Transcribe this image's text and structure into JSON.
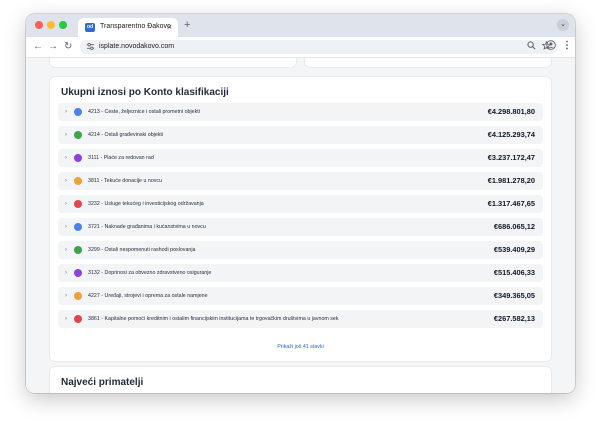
{
  "browser": {
    "tab_title": "Transparentno Đakovo",
    "favicon_text": "od",
    "new_tab": "+",
    "tab_close": "×",
    "tab_menu": "⌄",
    "url": "isplate.novodakovo.com",
    "nav": {
      "back": "←",
      "forward": "→",
      "reload": "↻"
    },
    "icons": {
      "site": "tune-icon",
      "zoom": "zoom-icon",
      "bookmark": "star-icon",
      "profile": "account-icon",
      "menu": "more-vert-icon"
    }
  },
  "konto": {
    "title": "Ukupni iznosi po Konto klasifikaciji",
    "rows": [
      {
        "label": "4213 - Ceste, željeznice i ostali prometni objekti",
        "amount": "€4.298.801,80",
        "color": "#4f82e8"
      },
      {
        "label": "4214 - Ostali građevinski objekti",
        "amount": "€4.125.293,74",
        "color": "#3fa34d"
      },
      {
        "label": "3111 - Plaće za redovan rad",
        "amount": "€3.237.172,47",
        "color": "#8e44d8"
      },
      {
        "label": "3811 - Tekuće donacije u novcu",
        "amount": "€1.981.278,20",
        "color": "#eea33a"
      },
      {
        "label": "3232 - Usluge tekućeg i investicijskog održavanja",
        "amount": "€1.317.467,65",
        "color": "#e0464a"
      },
      {
        "label": "3721 - Naknade građanima i kućanstvima u novcu",
        "amount": "€686.065,12",
        "color": "#4f82e8"
      },
      {
        "label": "3299 - Ostali nespomenuti rashodi poslovanja",
        "amount": "€539.409,29",
        "color": "#3fa34d"
      },
      {
        "label": "3132 - Doprinosi za obvezno zdravstveno osiguranje",
        "amount": "€515.406,33",
        "color": "#8e44d8"
      },
      {
        "label": "4227 - Uređaji, strojevi i oprema za ostale namjene",
        "amount": "€349.365,05",
        "color": "#eea33a"
      },
      {
        "label": "3861 - Kapitalne pomoći kreditnim i ostalim financijskim institucijama te trgovačkim društvima u javnom sek",
        "amount": "€267.582,13",
        "color": "#e0464a"
      }
    ],
    "chevron": "›",
    "more_link": "Prikaži još 41 stavki"
  },
  "primatelji": {
    "title": "Najveći primatelji"
  }
}
